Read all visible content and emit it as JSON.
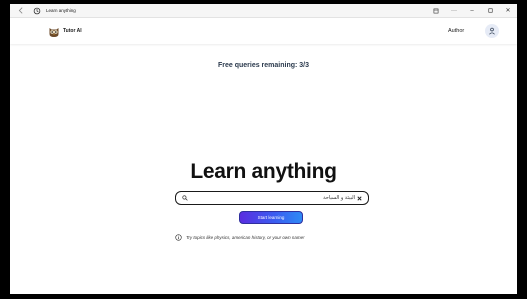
{
  "browser": {
    "tab_title": "Learn anything",
    "back_icon": "arrow-left-icon",
    "favicon": "tutor-favicon-icon",
    "controls": {
      "reader_icon": "window-icon",
      "more": "···",
      "minimize": "–",
      "maximize": "▫",
      "close": "✕"
    }
  },
  "header": {
    "brand": "Tutor AI",
    "logo_icon": "owl-logo-icon",
    "author_label": "Author",
    "avatar_icon": "user-icon"
  },
  "main": {
    "queries_remaining": "Free queries remaining: 3/3",
    "headline": "Learn anything",
    "search": {
      "value": "البيئة و السياحة",
      "placeholder": ""
    },
    "start_button": "Start learning",
    "tip": "Try topics like physics, american history, or your own name!"
  },
  "colors": {
    "accent_start": "#5a2de0",
    "accent_end": "#2f8af5",
    "text_dark": "#111111"
  }
}
